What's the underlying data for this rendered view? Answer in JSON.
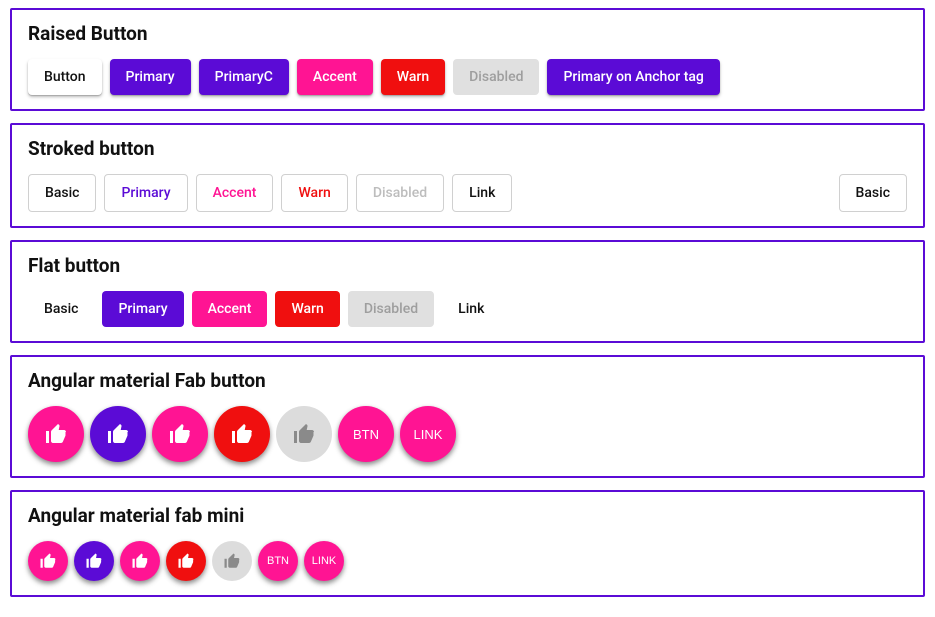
{
  "colors": {
    "primary": "#5b0bd6",
    "accent": "#ff1493",
    "warn": "#f00f0f",
    "disabledBg": "#e0e0e0"
  },
  "raised": {
    "title": "Raised Button",
    "buttons": {
      "basic": "Button",
      "primary": "Primary",
      "primaryc": "PrimaryC",
      "accent": "Accent",
      "warn": "Warn",
      "disabled": "Disabled",
      "anchor": "Primary on Anchor tag"
    }
  },
  "stroked": {
    "title": "Stroked button",
    "buttons": {
      "basic": "Basic",
      "primary": "Primary",
      "accent": "Accent",
      "warn": "Warn",
      "disabled": "Disabled",
      "link": "Link",
      "basicRight": "Basic"
    }
  },
  "flat": {
    "title": "Flat button",
    "buttons": {
      "basic": "Basic",
      "primary": "Primary",
      "accent": "Accent",
      "warn": "Warn",
      "disabled": "Disabled",
      "link": "Link"
    }
  },
  "fab": {
    "title": "Angular material Fab button",
    "btnLabel": "BTN",
    "linkLabel": "LINK",
    "iconName": "thumb-up-icon"
  },
  "fabmini": {
    "title": "Angular material fab mini",
    "btnLabel": "BTN",
    "linkLabel": "LINK",
    "iconName": "thumb-up-icon"
  }
}
